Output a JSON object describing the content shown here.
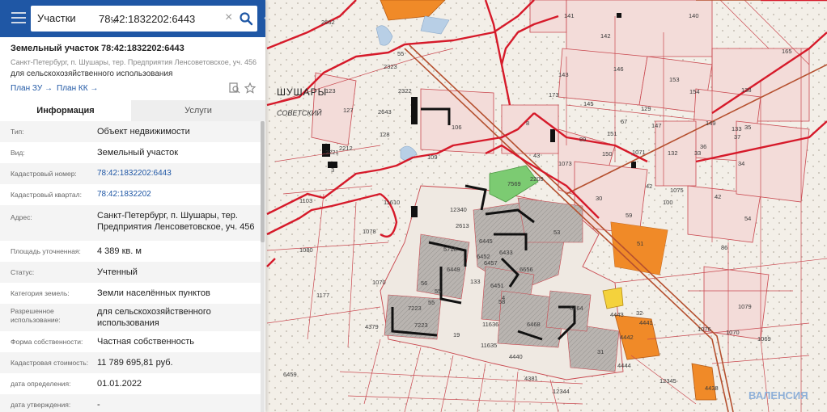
{
  "search": {
    "type": "Участки",
    "query": "78:42:1832202:6443"
  },
  "parcel": {
    "title": "Земельный участок 78:42:1832202:6443",
    "address": "Санкт-Петербург, п. Шушары, тер. Предприятия Ленсоветовское, уч. 456",
    "usage": "для сельскохозяйственного использования",
    "plan_zu": "План ЗУ",
    "plan_kk": "План КК"
  },
  "tabs": {
    "info": "Информация",
    "services": "Услуги"
  },
  "rows": [
    {
      "label": "Тип:",
      "value": "Объект недвижимости"
    },
    {
      "label": "Вид:",
      "value": "Земельный участок"
    },
    {
      "label": "Кадастровый номер:",
      "value": "78:42:1832202:6443"
    },
    {
      "label": "Кадастровый квартал:",
      "value": "78:42:1832202"
    },
    {
      "label": "Адрес:",
      "value": "Санкт-Петербург, п. Шушары, тер. Предприятия Ленсоветовское, уч. 456"
    },
    {
      "label": "Площадь уточненная:",
      "value": "4 389 кв. м"
    },
    {
      "label": "Статус:",
      "value": "Учтенный"
    },
    {
      "label": "Категория земель:",
      "value": "Земли населённых пунктов"
    },
    {
      "label": "Разрешенное использование:",
      "value": "для сельскохозяйственного использования"
    },
    {
      "label": "Форма собственности:",
      "value": "Частная собственность"
    },
    {
      "label": "Кадастровая стоимость:",
      "value": "11 789 695,81 руб."
    },
    {
      "label": "дата определения:",
      "value": "01.01.2022"
    },
    {
      "label": "дата утверждения:",
      "value": "-"
    }
  ],
  "map": {
    "place_label": "ШУШАРЫ",
    "road_label": "СОВЕТСКИЙ",
    "parcels": [
      "2662",
      "141",
      "140",
      "142",
      "165",
      "55",
      "2323",
      "106",
      "8",
      "143",
      "173",
      "145",
      "146",
      "153",
      "154",
      "138",
      "2322",
      "123",
      "127",
      "2643",
      "128",
      "129",
      "67",
      "151",
      "150",
      "147",
      "149",
      "133",
      "36",
      "37",
      "35",
      "3",
      "2212",
      "2221",
      "109",
      "7569",
      "43",
      "89",
      "1071",
      "132",
      "33",
      "34",
      "1103",
      "1073",
      "2209",
      "30",
      "42",
      "42",
      "100",
      "1075",
      "1078",
      "1080",
      "11610",
      "12340",
      "2613",
      "53",
      "51",
      "59",
      "54",
      "86",
      "1079",
      "1076",
      "1070",
      "1069",
      "1070",
      "1177",
      "4379",
      "7223",
      "7223",
      "55",
      "55",
      "56",
      "58",
      "6468",
      "6464",
      "31",
      "32",
      "4441",
      "4442",
      "4443",
      "4444",
      "4440",
      "4381",
      "12344",
      "12345",
      "4438",
      "19",
      "11635",
      "11636",
      "5718",
      "6449",
      "6451",
      "6452",
      "6445",
      "6457",
      "6433",
      "6656",
      "6459",
      "4",
      "133",
      "6468",
      "6450"
    ],
    "watermark": "ВАЛЕНСИЯ"
  },
  "colors": {
    "header": "#1f57a5",
    "road": "#d61a2a",
    "parcel_line": "#c9484f",
    "highlight": "#f08a28",
    "green_parcel": "#7ccb72"
  }
}
